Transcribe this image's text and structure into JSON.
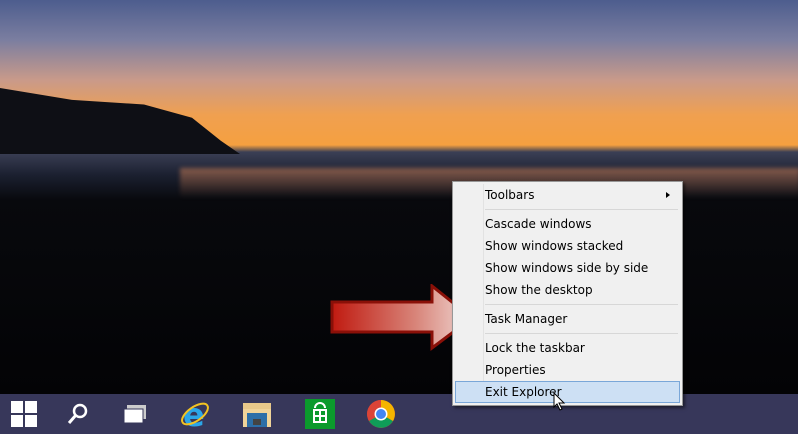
{
  "taskbar": {
    "icons": [
      "windows-start-icon",
      "search-icon",
      "task-view-icon",
      "internet-explorer-icon",
      "file-explorer-icon",
      "store-icon",
      "chrome-icon"
    ]
  },
  "menu": {
    "items": [
      {
        "label": "Toolbars"
      },
      {
        "label": "Cascade windows"
      },
      {
        "label": "Show windows stacked"
      },
      {
        "label": "Show windows side by side"
      },
      {
        "label": "Show the desktop"
      },
      {
        "label": "Task Manager"
      },
      {
        "label": "Lock the taskbar"
      },
      {
        "label": "Properties"
      },
      {
        "label": "Exit Explorer"
      }
    ]
  },
  "colors": {
    "taskbar": "#37375a",
    "arrow": "#c0201a",
    "highlight": "#cde0f4"
  }
}
